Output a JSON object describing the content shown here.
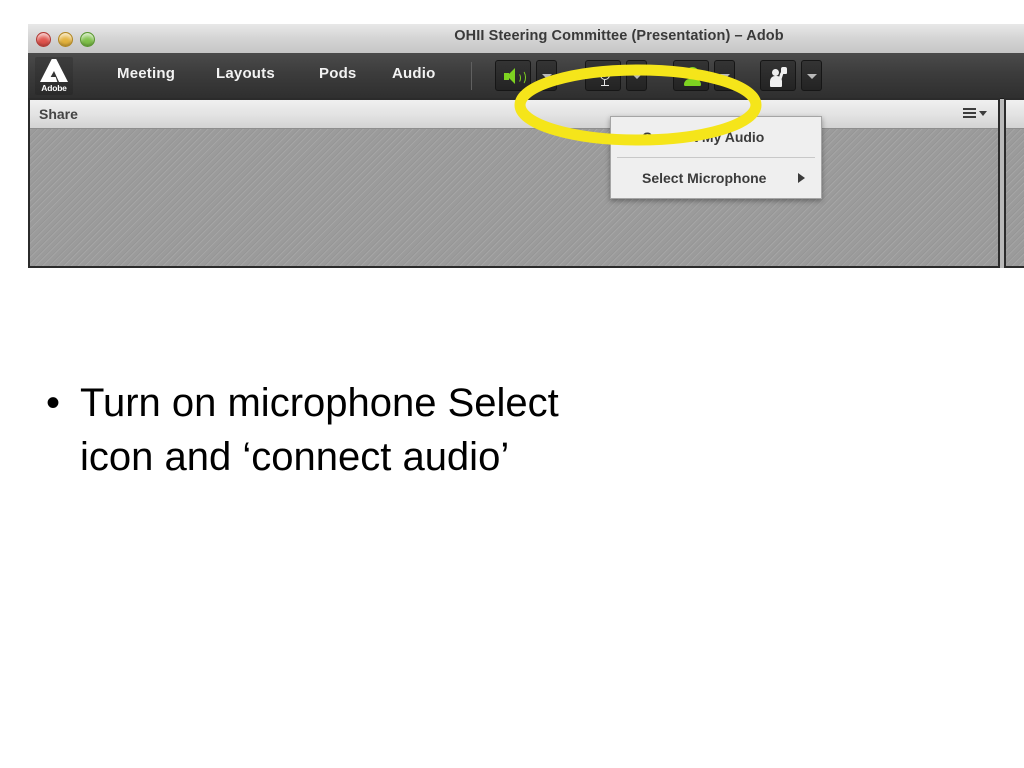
{
  "slide": {
    "bullet_marker": "•",
    "bullet_text_line1": "Turn on microphone Select",
    "bullet_text_line2": "icon and ‘connect audio’"
  },
  "window": {
    "title": "OHII Steering Committee (Presentation) – Adob",
    "traffic_lights": {
      "close": "close-button",
      "minimize": "minimize-button",
      "zoom": "zoom-button"
    },
    "brand": {
      "logo_letter": "A",
      "logo_word": "Adobe"
    },
    "menubar": [
      {
        "label": "Meeting"
      },
      {
        "label": "Layouts"
      },
      {
        "label": "Pods"
      },
      {
        "label": "Audio"
      }
    ],
    "toolbar": [
      {
        "icon": "speaker-icon",
        "state_color": "#7ed321",
        "has_dropdown": true
      },
      {
        "icon": "microphone-icon",
        "state_color": "#e8e8e8",
        "has_dropdown": true
      },
      {
        "icon": "webcam-icon",
        "state_color": "#7ed321",
        "has_dropdown": true
      },
      {
        "icon": "raise-hand-icon",
        "state_color": "#f0f0f0",
        "has_dropdown": true
      }
    ]
  },
  "share_pod": {
    "title": "Share",
    "menu_icon": "pod-options-icon"
  },
  "context_menu": {
    "items": [
      {
        "label": "Connect My Audio",
        "has_submenu": false
      },
      {
        "label": "Select Microphone",
        "has_submenu": true
      }
    ]
  },
  "annotation": {
    "shape": "ellipse",
    "color": "#f5e51a",
    "targets": "microphone-dropdown-and-connect-my-audio"
  }
}
